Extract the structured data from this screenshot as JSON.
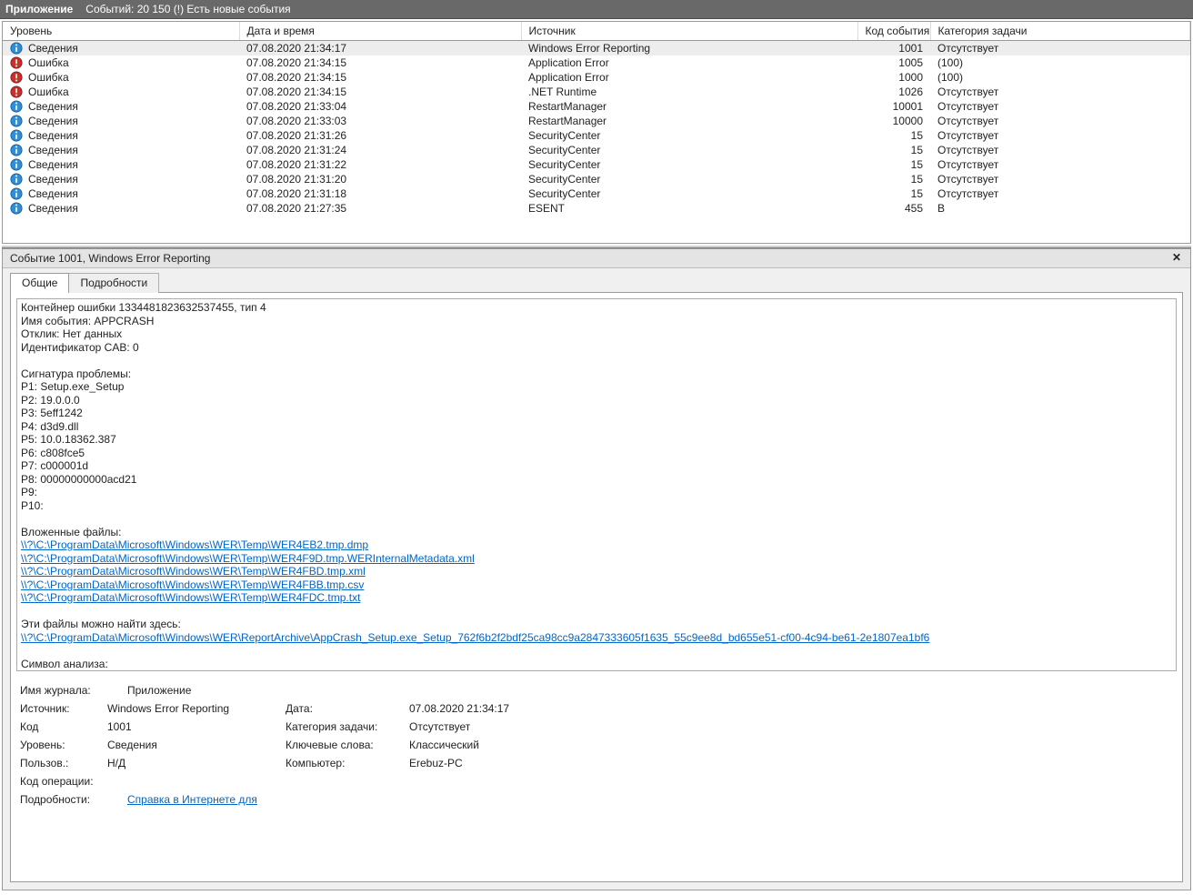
{
  "titlebar": {
    "app": "Приложение",
    "subtitle": "Событий: 20 150 (!) Есть новые события"
  },
  "columns": {
    "level": "Уровень",
    "datetime": "Дата и время",
    "source": "Источник",
    "code": "Код события",
    "category": "Категория задачи"
  },
  "level_labels": {
    "info": "Сведения",
    "error": "Ошибка"
  },
  "events": [
    {
      "level": "info",
      "datetime": "07.08.2020 21:34:17",
      "source": "Windows Error Reporting",
      "code": "1001",
      "category": "Отсутствует",
      "selected": true
    },
    {
      "level": "error",
      "datetime": "07.08.2020 21:34:15",
      "source": "Application Error",
      "code": "1005",
      "category": "(100)"
    },
    {
      "level": "error",
      "datetime": "07.08.2020 21:34:15",
      "source": "Application Error",
      "code": "1000",
      "category": "(100)"
    },
    {
      "level": "error",
      "datetime": "07.08.2020 21:34:15",
      "source": ".NET Runtime",
      "code": "1026",
      "category": "Отсутствует"
    },
    {
      "level": "info",
      "datetime": "07.08.2020 21:33:04",
      "source": "RestartManager",
      "code": "10001",
      "category": "Отсутствует"
    },
    {
      "level": "info",
      "datetime": "07.08.2020 21:33:03",
      "source": "RestartManager",
      "code": "10000",
      "category": "Отсутствует"
    },
    {
      "level": "info",
      "datetime": "07.08.2020 21:31:26",
      "source": "SecurityCenter",
      "code": "15",
      "category": "Отсутствует"
    },
    {
      "level": "info",
      "datetime": "07.08.2020 21:31:24",
      "source": "SecurityCenter",
      "code": "15",
      "category": "Отсутствует"
    },
    {
      "level": "info",
      "datetime": "07.08.2020 21:31:22",
      "source": "SecurityCenter",
      "code": "15",
      "category": "Отсутствует"
    },
    {
      "level": "info",
      "datetime": "07.08.2020 21:31:20",
      "source": "SecurityCenter",
      "code": "15",
      "category": "Отсутствует"
    },
    {
      "level": "info",
      "datetime": "07.08.2020 21:31:18",
      "source": "SecurityCenter",
      "code": "15",
      "category": "Отсутствует"
    },
    {
      "level": "info",
      "datetime": "07.08.2020 21:27:35",
      "source": "ESENT",
      "code": "455",
      "category": "В"
    }
  ],
  "details": {
    "header_title": "Событие 1001, Windows Error Reporting",
    "tabs": {
      "general": "Общие",
      "details": "Подробности"
    },
    "description_lines": [
      "Контейнер ошибки 1334481823632537455, тип 4",
      "Имя события: APPCRASH",
      "Отклик: Нет данных",
      "Идентификатор CAB: 0",
      "",
      "Сигнатура проблемы:",
      "P1: Setup.exe_Setup",
      "P2: 19.0.0.0",
      "P3: 5eff1242",
      "P4: d3d9.dll",
      "P5: 10.0.18362.387",
      "P6: c808fce5",
      "P7: c000001d",
      "P8: 00000000000acd21",
      "P9:",
      "P10:",
      "",
      "Вложенные файлы:"
    ],
    "attachment_links": [
      "\\\\?\\C:\\ProgramData\\Microsoft\\Windows\\WER\\Temp\\WER4EB2.tmp.dmp",
      "\\\\?\\C:\\ProgramData\\Microsoft\\Windows\\WER\\Temp\\WER4F9D.tmp.WERInternalMetadata.xml",
      "\\\\?\\C:\\ProgramData\\Microsoft\\Windows\\WER\\Temp\\WER4FBD.tmp.xml",
      "\\\\?\\C:\\ProgramData\\Microsoft\\Windows\\WER\\Temp\\WER4FBB.tmp.csv",
      "\\\\?\\C:\\ProgramData\\Microsoft\\Windows\\WER\\Temp\\WER4FDC.tmp.txt"
    ],
    "found_here_label": "Эти файлы можно найти здесь:",
    "found_here_link": "\\\\?\\C:\\ProgramData\\Microsoft\\Windows\\WER\\ReportArchive\\AppCrash_Setup.exe_Setup_762f6b2f2bdf25ca98cc9a2847333605f1635_55c9ee8d_bd655e51-cf00-4c94-be61-2e1807ea1bf6",
    "post_lines": [
      "",
      "Символ анализа:"
    ],
    "kv": {
      "log_name_label": "Имя журнала:",
      "log_name": "Приложение",
      "source_label": "Источник:",
      "source": "Windows Error Reporting",
      "date_label": "Дата:",
      "date": "07.08.2020 21:34:17",
      "code_label": "Код",
      "code": "1001",
      "category_label": "Категория задачи:",
      "category": "Отсутствует",
      "level_label": "Уровень:",
      "level": "Сведения",
      "keywords_label": "Ключевые слова:",
      "keywords": "Классический",
      "user_label": "Пользов.:",
      "user": "Н/Д",
      "computer_label": "Компьютер:",
      "computer": "Erebuz-PC",
      "opcode_label": "Код операции:",
      "opcode": "",
      "moreinfo_label": "Подробности:",
      "moreinfo_link": "Справка в Интернете для "
    }
  }
}
